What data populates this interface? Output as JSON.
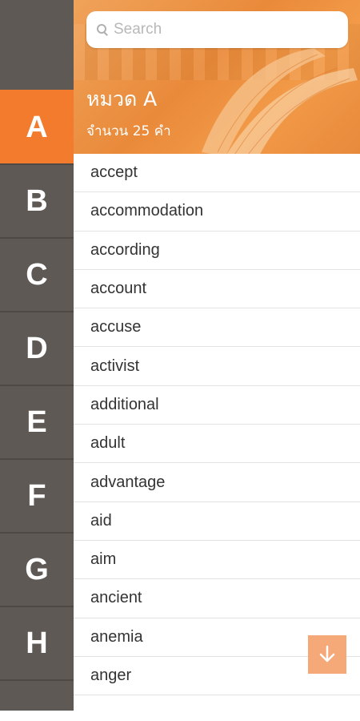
{
  "search": {
    "placeholder": "Search"
  },
  "category": {
    "title": "หมวด A",
    "count": "จำนวน 25 คำ"
  },
  "alphabet": [
    "A",
    "B",
    "C",
    "D",
    "E",
    "F",
    "G",
    "H"
  ],
  "active_letter": "A",
  "words": [
    "accept",
    "accommodation",
    "according",
    "account",
    "accuse",
    "activist",
    "additional",
    "adult",
    "advantage",
    "aid",
    "aim",
    "ancient",
    "anemia",
    "anger"
  ],
  "colors": {
    "accent": "#f37b2e",
    "rail": "#5f5955",
    "scroll_button": "#f5a878"
  },
  "icons": {
    "search": "search-icon",
    "scroll": "arrow-down-icon"
  }
}
